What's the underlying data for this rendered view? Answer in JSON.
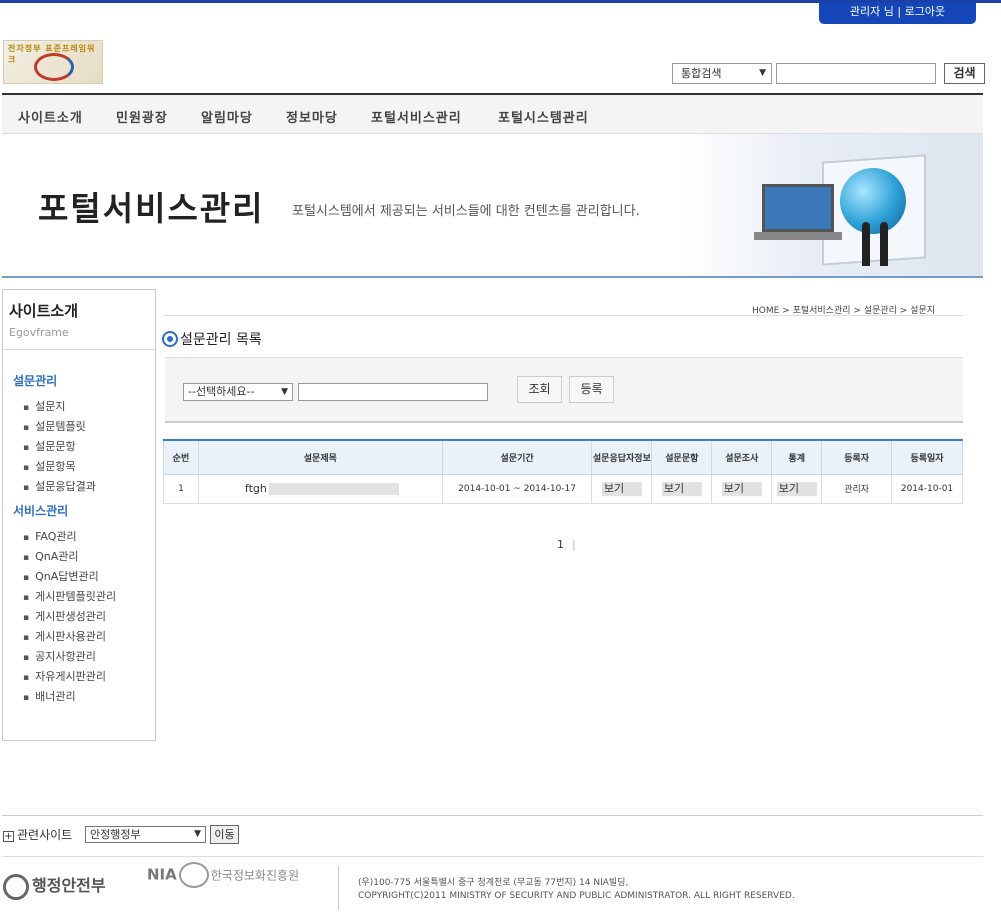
{
  "user": {
    "label": "관리자 님 | 로그아웃"
  },
  "logo": {
    "text": "전자정부 표준프레임워크"
  },
  "search": {
    "select_value": "통합검색",
    "button": "검색"
  },
  "gnb": [
    "사이트소개",
    "민원광장",
    "알림마당",
    "정보마당",
    "포털서비스관리",
    "포털시스템관리"
  ],
  "banner": {
    "title": "포털서비스관리",
    "desc": "포털시스템에서 제공되는 서비스들에 대한 컨텐츠를 관리합니다."
  },
  "lnb": {
    "title": "사이트소개",
    "subtitle": "Egovframe",
    "group1": "설문관리",
    "group1_items": [
      "설문지",
      "설문템플릿",
      "설문문항",
      "설문항목",
      "설문응답결과"
    ],
    "group2": "서비스관리",
    "group2_items": [
      "FAQ관리",
      "QnA관리",
      "QnA답변관리",
      "게시판템플릿관리",
      "게시판생성관리",
      "게시판사용관리",
      "공지사항관리",
      "자유게시판관리",
      "배너관리"
    ]
  },
  "location": "HOME > 포털서비스관리 > 설문관리 > 설문지",
  "page_title": "설문관리 목록",
  "filter": {
    "select_value": "--선택하세요--",
    "search_button": "조회",
    "register_button": "등록"
  },
  "table": {
    "headers": [
      "순번",
      "설문제목",
      "설문기간",
      "설문응답자정보",
      "설문문항",
      "설문조사",
      "통계",
      "등록자",
      "등록일자"
    ],
    "rows": [
      {
        "no": "1",
        "title": "ftgh",
        "period": "2014-10-01 ~ 2014-10-17",
        "respondent": "보기",
        "question": "보기",
        "survey": "보기",
        "stats": "보기",
        "writer": "관리자",
        "date": "2014-10-01"
      }
    ]
  },
  "pager": {
    "current": "1"
  },
  "footer": {
    "related_label": "관련사이트",
    "related_value": "안정행정부",
    "go_button": "이동",
    "mois": "행정안전부",
    "nia": "NIA",
    "nia_kr": "한국정보화진흥원",
    "addr1": "(우)100-775 서울특별시 중구 청계천로 (무교동 77번지) 14 NIA빌딩,",
    "addr2": "COPYRIGHT(C)2011 MINISTRY OF SECURITY AND PUBLIC ADMINISTRATOR. ALL RIGHT RESERVED."
  }
}
